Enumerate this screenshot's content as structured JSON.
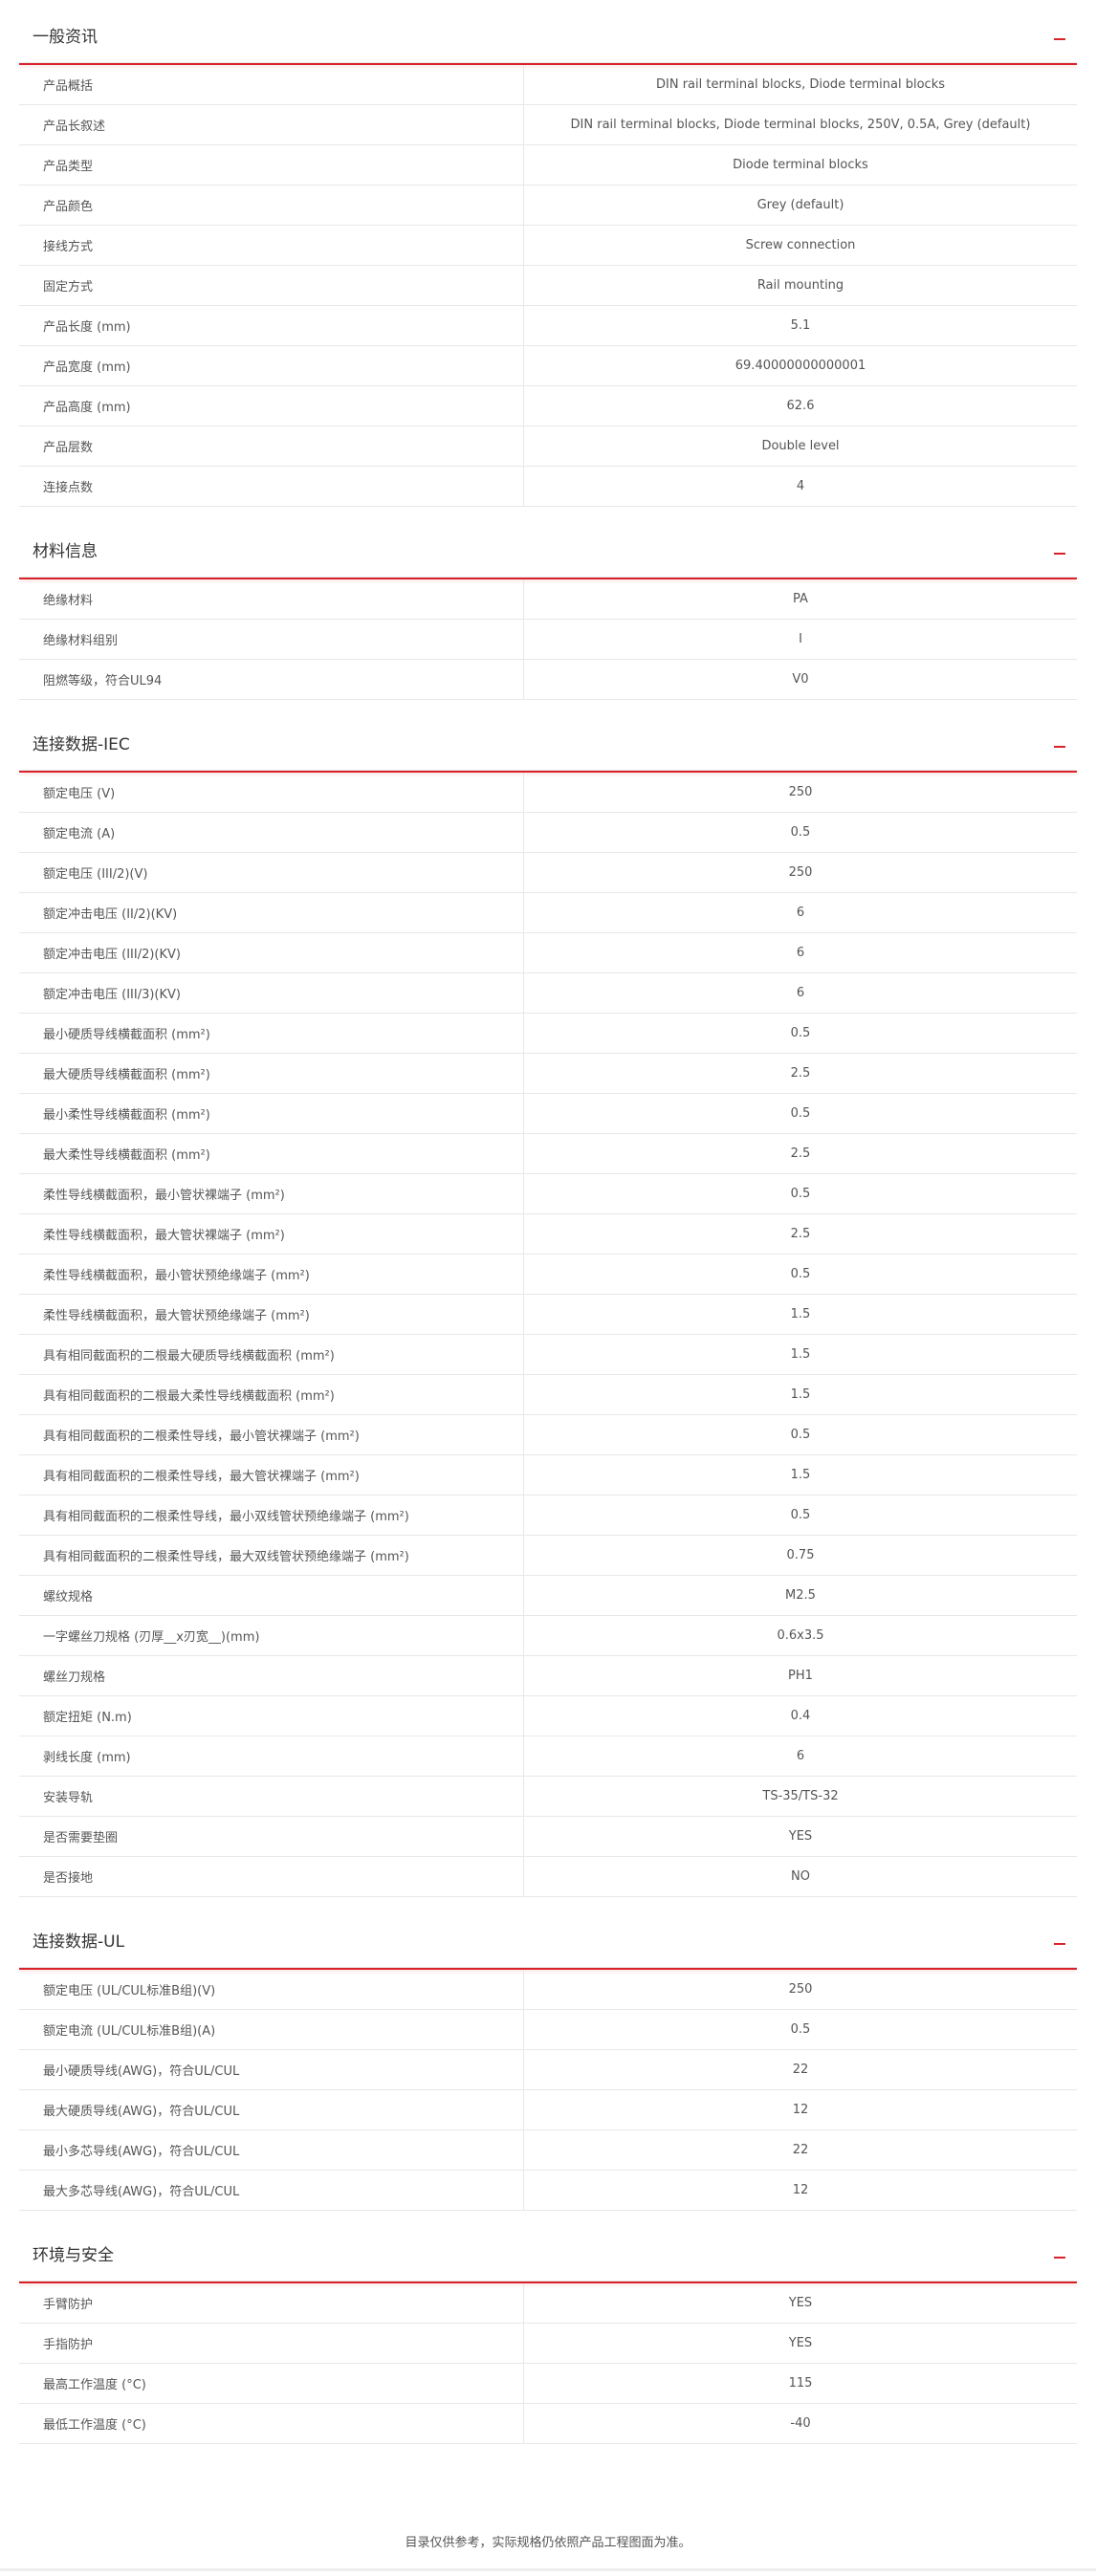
{
  "sections": [
    {
      "title": "一般资讯",
      "rows": [
        [
          "产品概括",
          "DIN rail terminal blocks, Diode terminal blocks"
        ],
        [
          "产品长叙述",
          "DIN rail terminal blocks, Diode terminal blocks, 250V, 0.5A, Grey (default)"
        ],
        [
          "产品类型",
          "Diode terminal blocks"
        ],
        [
          "产品颜色",
          "Grey (default)"
        ],
        [
          "接线方式",
          "Screw connection"
        ],
        [
          "固定方式",
          "Rail mounting"
        ],
        [
          "产品长度 (mm)",
          "5.1"
        ],
        [
          "产品宽度 (mm)",
          "69.40000000000001"
        ],
        [
          "产品高度 (mm)",
          "62.6"
        ],
        [
          "产品层数",
          "Double level"
        ],
        [
          "连接点数",
          "4"
        ]
      ]
    },
    {
      "title": "材料信息",
      "rows": [
        [
          "绝缘材料",
          "PA"
        ],
        [
          "绝缘材料组别",
          "I"
        ],
        [
          "阻燃等级，符合UL94",
          "V0"
        ]
      ]
    },
    {
      "title": "连接数据-IEC",
      "rows": [
        [
          "额定电压 (V)",
          "250"
        ],
        [
          "额定电流 (A)",
          "0.5"
        ],
        [
          "额定电压 (III/2)(V)",
          "250"
        ],
        [
          "额定冲击电压 (II/2)(KV)",
          "6"
        ],
        [
          "额定冲击电压 (III/2)(KV)",
          "6"
        ],
        [
          "额定冲击电压 (III/3)(KV)",
          "6"
        ],
        [
          "最小硬质导线横截面积 (mm²)",
          "0.5"
        ],
        [
          "最大硬质导线横截面积 (mm²)",
          "2.5"
        ],
        [
          "最小柔性导线横截面积 (mm²)",
          "0.5"
        ],
        [
          "最大柔性导线横截面积 (mm²)",
          "2.5"
        ],
        [
          "柔性导线横截面积，最小管状裸端子 (mm²)",
          "0.5"
        ],
        [
          "柔性导线横截面积，最大管状裸端子 (mm²)",
          "2.5"
        ],
        [
          "柔性导线横截面积，最小管状预绝缘端子 (mm²)",
          "0.5"
        ],
        [
          "柔性导线横截面积，最大管状预绝缘端子 (mm²)",
          "1.5"
        ],
        [
          "具有相同截面积的二根最大硬质导线横截面积 (mm²)",
          "1.5"
        ],
        [
          "具有相同截面积的二根最大柔性导线横截面积 (mm²)",
          "1.5"
        ],
        [
          "具有相同截面积的二根柔性导线，最小管状裸端子 (mm²)",
          "0.5"
        ],
        [
          "具有相同截面积的二根柔性导线，最大管状裸端子 (mm²)",
          "1.5"
        ],
        [
          "具有相同截面积的二根柔性导线，最小双线管状预绝缘端子 (mm²)",
          "0.5"
        ],
        [
          "具有相同截面积的二根柔性导线，最大双线管状预绝缘端子 (mm²)",
          "0.75"
        ],
        [
          "螺纹规格",
          "M2.5"
        ],
        [
          "一字螺丝刀规格 (刃厚__x刃宽__)(mm)",
          "0.6x3.5"
        ],
        [
          "螺丝刀规格",
          "PH1"
        ],
        [
          "额定扭矩 (N.m)",
          "0.4"
        ],
        [
          "剥线长度 (mm)",
          "6"
        ],
        [
          "安装导轨",
          "TS-35/TS-32"
        ],
        [
          "是否需要垫圈",
          "YES"
        ],
        [
          "是否接地",
          "NO"
        ]
      ]
    },
    {
      "title": "连接数据-UL",
      "rows": [
        [
          "额定电压 (UL/CUL标准B组)(V)",
          "250"
        ],
        [
          "额定电流 (UL/CUL标准B组)(A)",
          "0.5"
        ],
        [
          "最小硬质导线(AWG)，符合UL/CUL",
          "22"
        ],
        [
          "最大硬质导线(AWG)，符合UL/CUL",
          "12"
        ],
        [
          "最小多芯导线(AWG)，符合UL/CUL",
          "22"
        ],
        [
          "最大多芯导线(AWG)，符合UL/CUL",
          "12"
        ]
      ]
    },
    {
      "title": "环境与安全",
      "rows": [
        [
          "手臂防护",
          "YES"
        ],
        [
          "手指防护",
          "YES"
        ],
        [
          "最高工作温度 (°C)",
          "115"
        ],
        [
          "最低工作温度 (°C)",
          "-40"
        ]
      ]
    }
  ],
  "footer": {
    "note": "目录仅供参考，实际规格仍依照产品工程图面为准。"
  },
  "colors": {
    "accent": "#d9222a",
    "border": "#e8e8e8",
    "text": "#555555"
  },
  "icons": {
    "collapse": "minus-collapse-icon"
  }
}
